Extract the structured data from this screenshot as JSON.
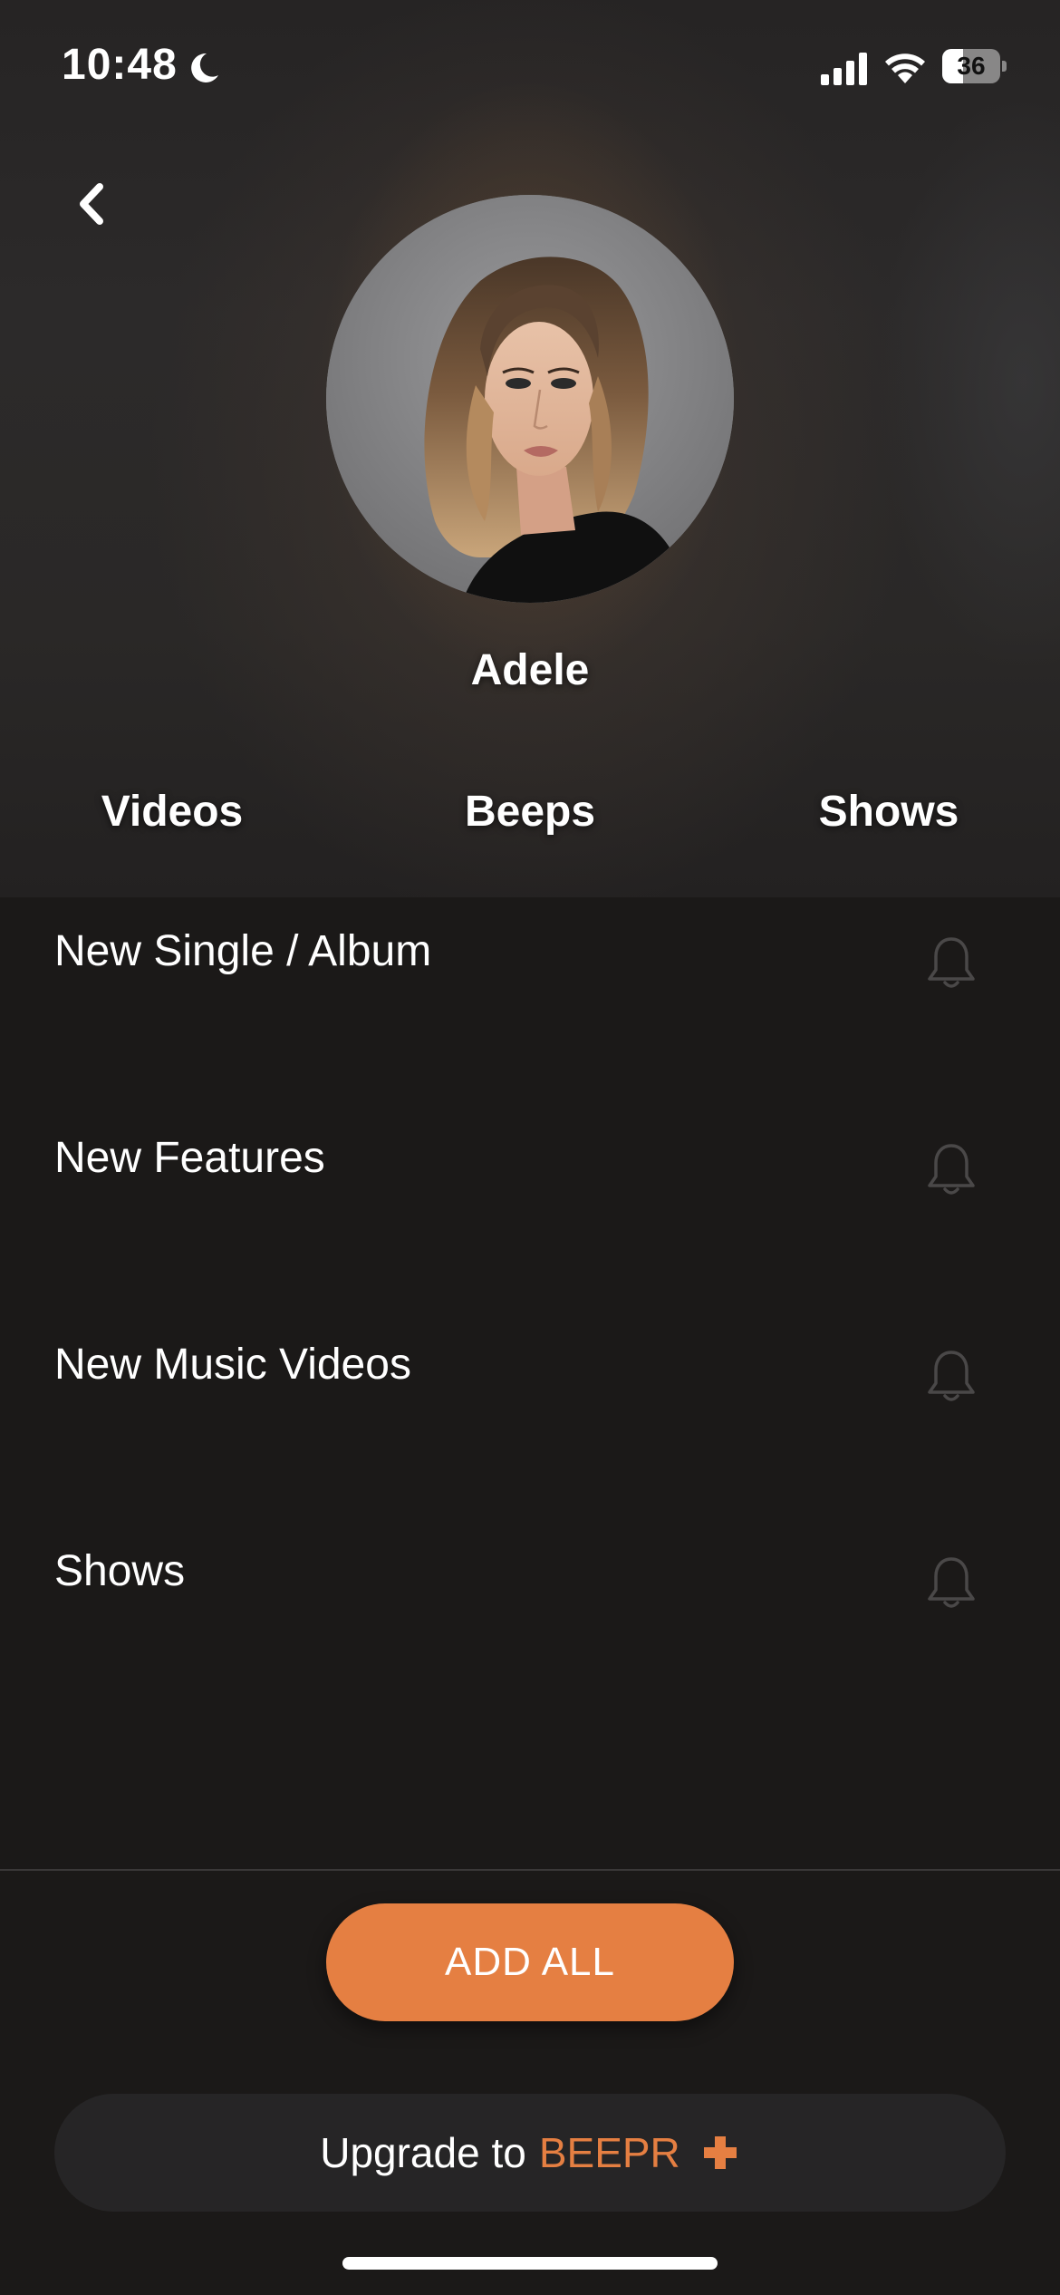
{
  "status_bar": {
    "time": "10:48",
    "battery_level": "36",
    "battery_fraction": 0.36
  },
  "artist": {
    "name": "Adele"
  },
  "tabs": [
    {
      "label": "Videos"
    },
    {
      "label": "Beeps"
    },
    {
      "label": "Shows"
    }
  ],
  "notifications": [
    {
      "label": "New Single / Album",
      "icon": "bell-icon"
    },
    {
      "label": "New Features",
      "icon": "bell-icon"
    },
    {
      "label": "New Music Videos",
      "icon": "bell-icon"
    },
    {
      "label": "Shows",
      "icon": "bell-icon"
    }
  ],
  "actions": {
    "add_all_label": "ADD ALL",
    "upgrade_prefix": "Upgrade to",
    "upgrade_brand": "BEEPR"
  },
  "colors": {
    "accent": "#e57f42",
    "background": "#1b1918",
    "icon_muted": "#4a4848"
  }
}
